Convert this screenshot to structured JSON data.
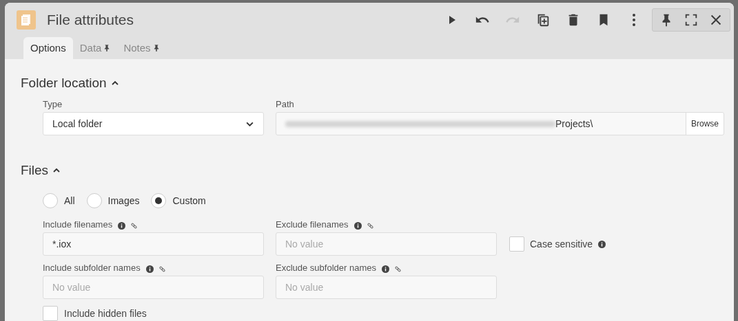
{
  "window": {
    "title": "File attributes"
  },
  "toolbar": [
    {
      "kind": "play",
      "disabled": false
    },
    {
      "kind": "undo",
      "disabled": false
    },
    {
      "kind": "redo",
      "disabled": true
    },
    {
      "kind": "duplicate",
      "disabled": false
    },
    {
      "kind": "delete",
      "disabled": false
    },
    {
      "kind": "bookmark",
      "disabled": false
    },
    {
      "kind": "more",
      "disabled": false
    }
  ],
  "window_controls": [
    {
      "kind": "pin"
    },
    {
      "kind": "expand"
    },
    {
      "kind": "close"
    }
  ],
  "tabs": [
    {
      "label": "Options",
      "selected": true,
      "pinned": false
    },
    {
      "label": "Data",
      "selected": false,
      "pinned": true
    },
    {
      "label": "Notes",
      "selected": false,
      "pinned": true
    }
  ],
  "folder_location": {
    "heading": "Folder location",
    "expanded": true,
    "type": {
      "label": "Type",
      "value": "Local folder"
    },
    "path": {
      "label": "Path",
      "value": "Projects\\",
      "browse": "Browse"
    }
  },
  "files": {
    "heading": "Files",
    "expanded": true,
    "filter": [
      {
        "label": "All",
        "selected": false
      },
      {
        "label": "Images",
        "selected": false
      },
      {
        "label": "Custom",
        "selected": true
      }
    ],
    "fields": [
      {
        "label": "Include filenames",
        "value": "*.iox"
      },
      {
        "label": "Exclude filenames",
        "placeholder": "No value"
      },
      {
        "label": "Include subfolder names",
        "placeholder": "No value"
      },
      {
        "label": "Exclude subfolder names",
        "placeholder": "No value"
      }
    ],
    "case_sensitive": {
      "label": "Case sensitive",
      "checked": false
    },
    "hidden_files": {
      "label": "Include hidden files",
      "checked": false
    }
  }
}
